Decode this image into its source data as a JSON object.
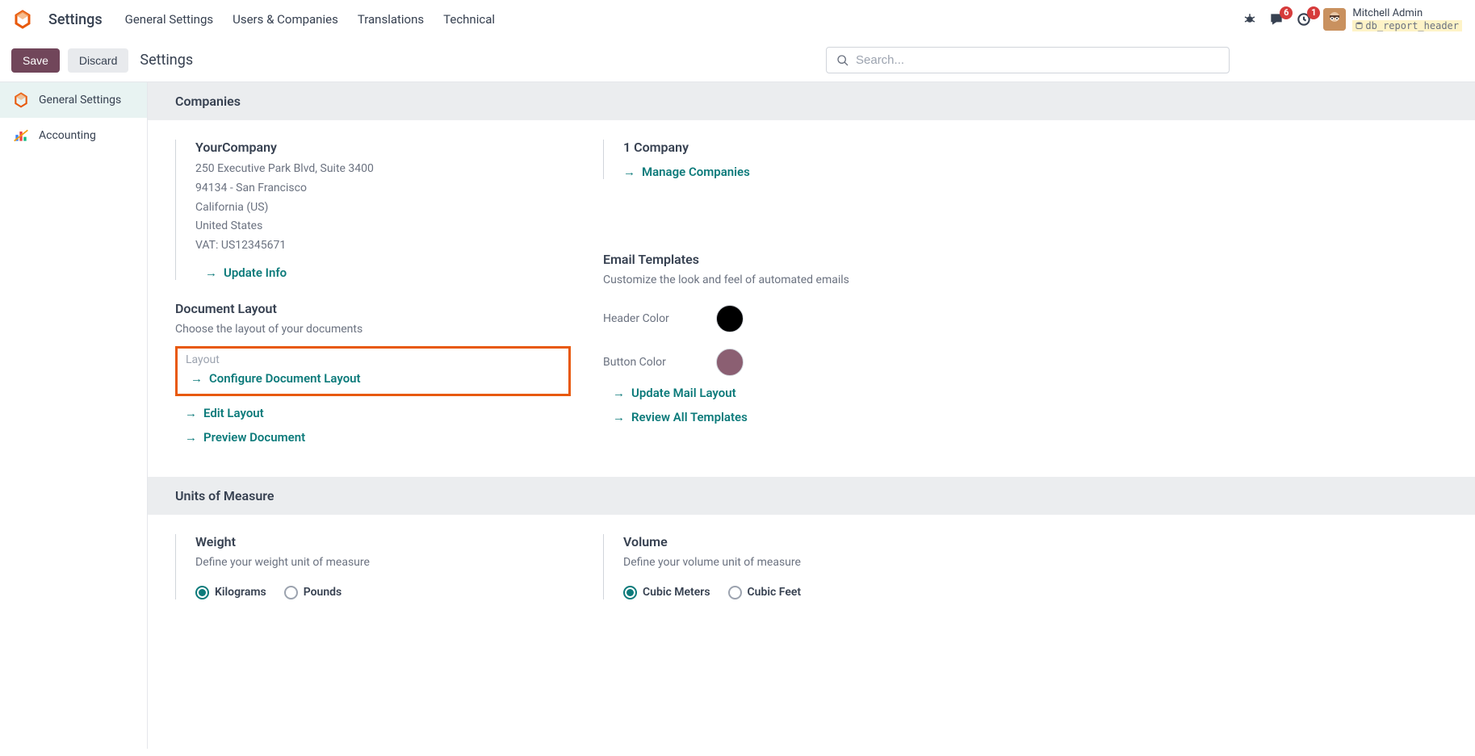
{
  "navbar": {
    "app_name": "Settings",
    "menu": [
      "General Settings",
      "Users & Companies",
      "Translations",
      "Technical"
    ],
    "badges": {
      "messages": "6",
      "activities": "1"
    },
    "user": {
      "name": "Mitchell Admin",
      "db": "db_report_header"
    }
  },
  "actionbar": {
    "save": "Save",
    "discard": "Discard",
    "title": "Settings",
    "search_placeholder": "Search..."
  },
  "sidebar": {
    "items": [
      {
        "label": "General Settings"
      },
      {
        "label": "Accounting"
      }
    ]
  },
  "sections": {
    "companies": {
      "header": "Companies",
      "company": {
        "name": "YourCompany",
        "addr1": "250 Executive Park Blvd, Suite 3400",
        "addr2": "94134 - San Francisco",
        "addr3": "California (US)",
        "addr4": "United States",
        "vat": "VAT:  US12345671",
        "update_link": "Update Info"
      },
      "multi": {
        "title": "1 Company",
        "manage_link": "Manage Companies"
      },
      "doc_layout": {
        "title": "Document Layout",
        "desc": "Choose the layout of your documents",
        "label": "Layout",
        "configure_link": "Configure Document Layout",
        "edit_link": "Edit Layout",
        "preview_link": "Preview Document"
      },
      "email_templates": {
        "title": "Email Templates",
        "desc": "Customize the look and feel of automated emails",
        "header_color_label": "Header Color",
        "header_color": "#000000",
        "button_color_label": "Button Color",
        "button_color": "#8b5f72",
        "update_link": "Update Mail Layout",
        "review_link": "Review All Templates"
      }
    },
    "units": {
      "header": "Units of Measure",
      "weight": {
        "title": "Weight",
        "desc": "Define your weight unit of measure",
        "opts": [
          "Kilograms",
          "Pounds"
        ],
        "selected": "Kilograms"
      },
      "volume": {
        "title": "Volume",
        "desc": "Define your volume unit of measure",
        "opts": [
          "Cubic Meters",
          "Cubic Feet"
        ],
        "selected": "Cubic Meters"
      }
    }
  }
}
